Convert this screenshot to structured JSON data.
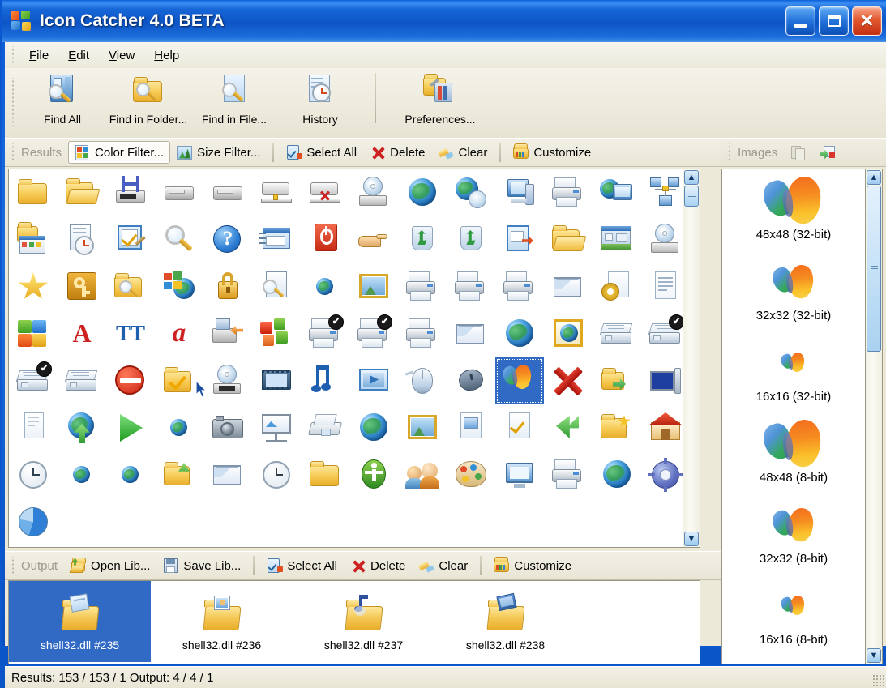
{
  "window": {
    "title": "Icon Catcher 4.0 BETA",
    "icon": "puzzle-icon",
    "minimize_label": "Minimize",
    "maximize_label": "Maximize",
    "close_label": "Close",
    "titlebar_color": "#1666d8"
  },
  "menu": {
    "items": [
      {
        "label": "File",
        "accel": "F"
      },
      {
        "label": "Edit",
        "accel": "E"
      },
      {
        "label": "View",
        "accel": "V"
      },
      {
        "label": "Help",
        "accel": "H"
      }
    ]
  },
  "toolbar": {
    "buttons": [
      {
        "label": "Find All",
        "icon": "find-all-icon"
      },
      {
        "label": "Find in Folder...",
        "icon": "find-folder-icon"
      },
      {
        "label": "Find in File...",
        "icon": "find-file-icon"
      },
      {
        "label": "History",
        "icon": "history-clock-icon"
      }
    ],
    "buttons_after_separator": [
      {
        "label": "Preferences...",
        "icon": "preferences-icon"
      }
    ]
  },
  "results_band": {
    "title": "Results",
    "buttons": [
      {
        "label": "Color Filter...",
        "icon": "color-filter-icon",
        "state": "hot"
      },
      {
        "label": "Size Filter...",
        "icon": "size-filter-icon",
        "state": "normal"
      },
      {
        "label": "Select All",
        "icon": "select-all-icon",
        "state": "normal"
      },
      {
        "label": "Delete",
        "icon": "delete-x-icon",
        "state": "normal"
      },
      {
        "label": "Clear",
        "icon": "clear-brush-icon",
        "state": "normal"
      },
      {
        "label": "Customize",
        "icon": "customize-icon",
        "state": "normal"
      }
    ]
  },
  "images_band": {
    "title": "Images",
    "buttons": [
      {
        "label": "Copy",
        "icon": "copy-clipboard-icon",
        "enabled": false
      },
      {
        "label": "Export Image",
        "icon": "export-image-icon",
        "enabled": true
      }
    ]
  },
  "output_band": {
    "title": "Output",
    "buttons": [
      {
        "label": "Open Lib...",
        "icon": "open-library-icon"
      },
      {
        "label": "Save Lib...",
        "icon": "save-library-icon"
      },
      {
        "label": "Select All",
        "icon": "select-all-icon"
      },
      {
        "label": "Delete",
        "icon": "delete-x-icon"
      },
      {
        "label": "Clear",
        "icon": "clear-brush-icon"
      },
      {
        "label": "Customize",
        "icon": "customize-icon"
      }
    ]
  },
  "results": {
    "columns": 14,
    "selected_index": 67,
    "icons": [
      {
        "icon": "folder-closed-icon",
        "kind": "folder"
      },
      {
        "icon": "folder-open-icon",
        "kind": "folder-open"
      },
      {
        "icon": "hardware-h-icon",
        "kind": "device"
      },
      {
        "icon": "drive-icon",
        "kind": "drive"
      },
      {
        "icon": "network-drive-icon",
        "kind": "drive"
      },
      {
        "icon": "network-drive-connected-icon",
        "kind": "drive-net"
      },
      {
        "icon": "network-drive-disconnected-icon",
        "kind": "drive-net-x"
      },
      {
        "icon": "cd-drive-icon",
        "kind": "optical"
      },
      {
        "icon": "globe-icon",
        "kind": "globe"
      },
      {
        "icon": "web-disc-icon",
        "kind": "globe-disc"
      },
      {
        "icon": "computer-icon",
        "kind": "computer"
      },
      {
        "icon": "printer-icon",
        "kind": "printer"
      },
      {
        "icon": "network-computer-icon",
        "kind": "computer-net"
      },
      {
        "icon": "network-group-icon",
        "kind": "net-group"
      },
      {
        "icon": "folder-programs-icon",
        "kind": "folder-win"
      },
      {
        "icon": "recent-documents-icon",
        "kind": "doc-clock"
      },
      {
        "icon": "checklist-edit-icon",
        "kind": "check-pen"
      },
      {
        "icon": "search-magnifier-icon",
        "kind": "magnifier"
      },
      {
        "icon": "help-question-icon",
        "kind": "help"
      },
      {
        "icon": "run-dialog-icon",
        "kind": "run"
      },
      {
        "icon": "shutdown-icon",
        "kind": "power"
      },
      {
        "icon": "hand-share-icon",
        "kind": "hand"
      },
      {
        "icon": "recycle-bin-empty-icon",
        "kind": "recycle"
      },
      {
        "icon": "recycle-bin-full-icon",
        "kind": "recycle"
      },
      {
        "icon": "shortcut-arrow-icon",
        "kind": "shortcut"
      },
      {
        "icon": "folder-open-green-icon",
        "kind": "folder-open"
      },
      {
        "icon": "desktop-icon",
        "kind": "desktop"
      },
      {
        "icon": "cd-audio-icon",
        "kind": "optical"
      },
      {
        "icon": "favorites-star-icon",
        "kind": "star"
      },
      {
        "icon": "key-password-icon",
        "kind": "key"
      },
      {
        "icon": "search-folder-icon",
        "kind": "folder-search"
      },
      {
        "icon": "windows-update-icon",
        "kind": "windows-globe"
      },
      {
        "icon": "lock-icon",
        "kind": "lock"
      },
      {
        "icon": "search-doc-icon",
        "kind": "doc-search"
      },
      {
        "icon": "small-globe-icon",
        "kind": "globe-small"
      },
      {
        "icon": "picture-frame-icon",
        "kind": "picture"
      },
      {
        "icon": "printer-add-icon",
        "kind": "printer"
      },
      {
        "icon": "printer-net-icon",
        "kind": "printer"
      },
      {
        "icon": "printer-share-icon",
        "kind": "printer"
      },
      {
        "icon": "mail-send-icon",
        "kind": "mail"
      },
      {
        "icon": "settings-gear-doc-icon",
        "kind": "gear-doc"
      },
      {
        "icon": "notepad-icon",
        "kind": "notepad"
      },
      {
        "icon": "puzzle-plugin-icon",
        "kind": "puzzle"
      },
      {
        "icon": "font-a-icon",
        "kind": "fonta"
      },
      {
        "icon": "truetype-font-icon",
        "kind": "fontt"
      },
      {
        "icon": "italic-font-icon",
        "kind": "fonti"
      },
      {
        "icon": "backup-restore-icon",
        "kind": "device-arrow"
      },
      {
        "icon": "color-blocks-icon",
        "kind": "blocks"
      },
      {
        "icon": "printer-check-icon",
        "kind": "printer",
        "badge": "check"
      },
      {
        "icon": "printer-check2-icon",
        "kind": "printer",
        "badge": "check"
      },
      {
        "icon": "printer-plain-icon",
        "kind": "printer"
      },
      {
        "icon": "mail-envelope-icon",
        "kind": "mail"
      },
      {
        "icon": "globe-web-icon",
        "kind": "globe"
      },
      {
        "icon": "web-page-icon",
        "kind": "picture-globe"
      },
      {
        "icon": "fax-icon",
        "kind": "fax"
      },
      {
        "icon": "fax-check-icon",
        "kind": "fax",
        "badge": "check"
      },
      {
        "icon": "fax-check3-icon",
        "kind": "fax",
        "badge": "check"
      },
      {
        "icon": "fax-plain-icon",
        "kind": "fax"
      },
      {
        "icon": "no-entry-icon",
        "kind": "noentry"
      },
      {
        "icon": "folder-check-icon",
        "kind": "folder-check"
      },
      {
        "icon": "dvd-drive-icon",
        "kind": "dvd"
      },
      {
        "icon": "film-video-icon",
        "kind": "film"
      },
      {
        "icon": "music-note-icon",
        "kind": "music"
      },
      {
        "icon": "media-player-icon",
        "kind": "media"
      },
      {
        "icon": "mouse-icon",
        "kind": "mouse"
      },
      {
        "icon": "mouse-dark-icon",
        "kind": "mouse2"
      },
      {
        "icon": "butterfly-icon",
        "kind": "butterfly",
        "selected": true
      },
      {
        "icon": "red-x-icon",
        "kind": "redx"
      },
      {
        "icon": "folder-export-icon",
        "kind": "folder-arrow"
      },
      {
        "icon": "display-settings-icon",
        "kind": "display"
      },
      {
        "icon": "document-blank-icon",
        "kind": "docblank"
      },
      {
        "icon": "globe-up-icon",
        "kind": "globe-up"
      },
      {
        "icon": "play-green-icon",
        "kind": "play"
      },
      {
        "icon": "globe-blue-icon",
        "kind": "globe-small"
      },
      {
        "icon": "camera-icon",
        "kind": "camera"
      },
      {
        "icon": "presentation-icon",
        "kind": "present"
      },
      {
        "icon": "scanner-icon",
        "kind": "scanner"
      },
      {
        "icon": "globe-world-icon",
        "kind": "globe"
      },
      {
        "icon": "image-file-icon",
        "kind": "picture"
      },
      {
        "icon": "document-image-icon",
        "kind": "docimg"
      },
      {
        "icon": "checklist-doc-icon",
        "kind": "doccheck"
      },
      {
        "icon": "green-arrow-icon",
        "kind": "greenarrow"
      },
      {
        "icon": "folder-star-icon",
        "kind": "folder-star"
      },
      {
        "icon": "home-house-icon",
        "kind": "house"
      },
      {
        "icon": "clock-icon",
        "kind": "clock"
      },
      {
        "icon": "globe-gray-icon",
        "kind": "globe-small"
      },
      {
        "icon": "globe-small2-icon",
        "kind": "globe-small"
      },
      {
        "icon": "folder-green-icon",
        "kind": "folder-green"
      },
      {
        "icon": "envelope-small-icon",
        "kind": "mail"
      },
      {
        "icon": "clock-small-icon",
        "kind": "clock"
      },
      {
        "icon": "folder-yellow-icon",
        "kind": "folder"
      },
      {
        "icon": "accessibility-icon",
        "kind": "access"
      },
      {
        "icon": "users-group-icon",
        "kind": "users"
      },
      {
        "icon": "palette-icon",
        "kind": "palette"
      },
      {
        "icon": "display-blue-icon",
        "kind": "display2"
      },
      {
        "icon": "printer-gray-icon",
        "kind": "printer"
      },
      {
        "icon": "globe-net-icon",
        "kind": "globe"
      },
      {
        "icon": "gear-settings-icon",
        "kind": "gear"
      },
      {
        "icon": "pie-chart-icon",
        "kind": "pie"
      }
    ]
  },
  "images_panel": {
    "items": [
      {
        "label": "48x48 (32-bit)",
        "size": 48,
        "icon": "butterfly-icon"
      },
      {
        "label": "32x32 (32-bit)",
        "size": 34,
        "icon": "butterfly-icon"
      },
      {
        "label": "16x16 (32-bit)",
        "size": 20,
        "icon": "butterfly-icon"
      },
      {
        "label": "48x48 (8-bit)",
        "size": 48,
        "icon": "butterfly-icon"
      },
      {
        "label": "32x32 (8-bit)",
        "size": 34,
        "icon": "butterfly-icon"
      },
      {
        "label": "16x16 (8-bit)",
        "size": 20,
        "icon": "butterfly-icon"
      }
    ]
  },
  "output_panel": {
    "items": [
      {
        "label": "shell32.dll #235",
        "icon": "folder-document-icon",
        "selected": true
      },
      {
        "label": "shell32.dll #236",
        "icon": "folder-picture-icon",
        "selected": false
      },
      {
        "label": "shell32.dll #237",
        "icon": "folder-music-icon",
        "selected": false
      },
      {
        "label": "shell32.dll #238",
        "icon": "folder-video-icon",
        "selected": false
      }
    ]
  },
  "status": {
    "text": "Results: 153 / 153 / 1   Output: 4 / 4 / 1"
  },
  "cursor": {
    "icon": "mouse-pointer-icon"
  }
}
